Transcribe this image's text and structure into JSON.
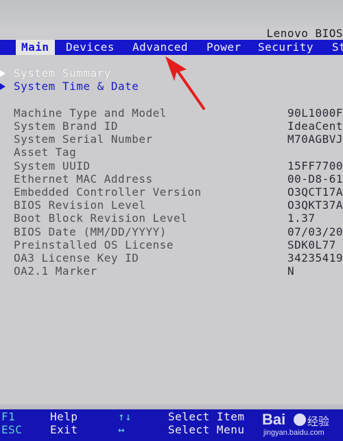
{
  "header": {
    "title": "Lenovo BIOS"
  },
  "menu": {
    "items": [
      {
        "label": "Main",
        "active": true
      },
      {
        "label": "Devices",
        "active": false
      },
      {
        "label": "Advanced",
        "active": false
      },
      {
        "label": "Power",
        "active": false
      },
      {
        "label": "Security",
        "active": false
      },
      {
        "label": "St",
        "active": false
      }
    ]
  },
  "nav": {
    "system_summary": "System Summary",
    "system_time_date": "System Time & Date"
  },
  "info": [
    {
      "label": "Machine Type and Model",
      "value": "90L1000F"
    },
    {
      "label": "System Brand ID",
      "value": "IdeaCent"
    },
    {
      "label": "System Serial Number",
      "value": "M70AGBVJ"
    },
    {
      "label": "Asset Tag",
      "value": ""
    },
    {
      "label": "System UUID",
      "value": "15FF7700"
    },
    {
      "label": "Ethernet MAC Address",
      "value": "00-D8-61"
    },
    {
      "label": "Embedded Controller Version",
      "value": "O3QCT17A"
    },
    {
      "label": "BIOS Revision Level",
      "value": "O3QKT37A"
    },
    {
      "label": "Boot Block Revision Level",
      "value": "1.37"
    },
    {
      "label": "BIOS Date (MM/DD/YYYY)",
      "value": "07/03/20"
    },
    {
      "label": "Preinstalled OS License",
      "value": "SDK0L77"
    },
    {
      "label": "OA3 License Key ID",
      "value": "34235419"
    },
    {
      "label": "OA2.1 Marker",
      "value": "N"
    }
  ],
  "footer": {
    "row1": {
      "key1": "F1",
      "desc1": "Help",
      "key2": "↑↓",
      "desc2": "Select Item"
    },
    "row2": {
      "key1": "ESC",
      "desc1": "Exit",
      "key2": "↔",
      "desc2": "Select Menu"
    }
  },
  "watermark": {
    "brand": "Bai",
    "text": "经验",
    "site": "jingyan.baidu.com"
  },
  "colors": {
    "background": "#ccccce",
    "menubar": "#1616cc",
    "footer": "#1414b4",
    "arrow": "#e41d1d",
    "selected_text": "#ffffff",
    "label_text": "#4e4e56"
  }
}
